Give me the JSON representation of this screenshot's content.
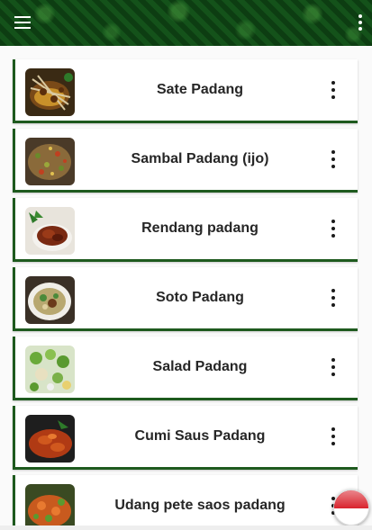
{
  "appbar": {
    "menu_icon": "hamburger-icon",
    "overflow_icon": "vertical-dots-icon"
  },
  "recipes": [
    {
      "title": "Sate Padang",
      "image": "sate-padang-photo"
    },
    {
      "title": "Sambal Padang (ijo)",
      "image": "sambal-padang-photo"
    },
    {
      "title": "Rendang padang",
      "image": "rendang-padang-photo"
    },
    {
      "title": "Soto Padang",
      "image": "soto-padang-photo"
    },
    {
      "title": "Salad Padang",
      "image": "salad-padang-photo"
    },
    {
      "title": "Cumi Saus Padang",
      "image": "cumi-saus-padang-photo"
    },
    {
      "title": "Udang pete saos padang",
      "image": "udang-pete-photo"
    }
  ],
  "fab": {
    "icon": "indonesia-flag-icon"
  },
  "colors": {
    "appbar": "#14521a",
    "card_accent": "#1e5a1e",
    "title_text": "#262626",
    "flag_red": "#d9232d",
    "flag_white": "#ffffff"
  }
}
